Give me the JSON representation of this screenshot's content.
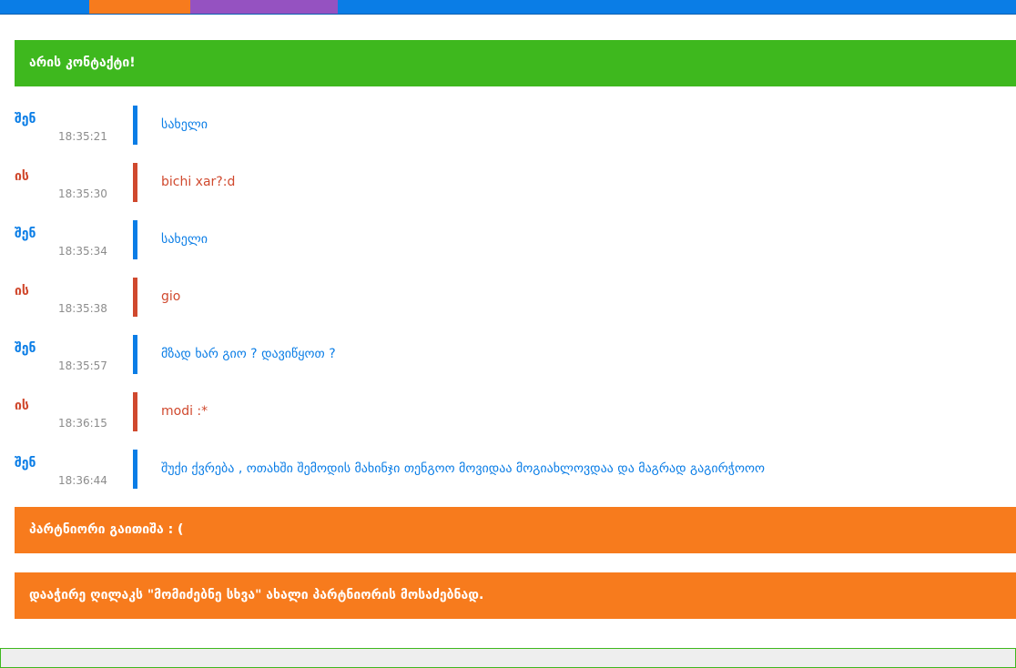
{
  "colors": {
    "nav_blue": "#0a7de6",
    "nav_orange": "#f77b1d",
    "nav_purple": "#9552c1",
    "connected_green": "#3eb81e",
    "notice_orange": "#f77b1d",
    "me_blue": "#0a7de6",
    "partner_red": "#d0492e"
  },
  "status": {
    "connected": "არის კონტაქტი!",
    "disconnected": "პარტნიორი გაითიშა : (",
    "hint": "დააჭირე ღილაკს \"მომიძებნე სხვა\" ახალი პარტნიორის მოსაძებნად."
  },
  "messages": [
    {
      "sender": "შენ",
      "time": "18:35:21",
      "text": "სახელი"
    },
    {
      "sender": "ის",
      "time": "18:35:30",
      "text": "bichi xar?:d"
    },
    {
      "sender": "შენ",
      "time": "18:35:34",
      "text": "სახელი"
    },
    {
      "sender": "ის",
      "time": "18:35:38",
      "text": "gio"
    },
    {
      "sender": "შენ",
      "time": "18:35:57",
      "text": "მზად ხარ გიო ? დავიწყოთ ?"
    },
    {
      "sender": "ის",
      "time": "18:36:15",
      "text": "modi :*"
    },
    {
      "sender": "შენ",
      "time": "18:36:44",
      "text": "შუქი ქვრება , ოთახში შემოდის მახინჯი თენგოო მოვიდაა მოგიახლოვდაა და მაგრად გაგირჭოოო"
    }
  ]
}
